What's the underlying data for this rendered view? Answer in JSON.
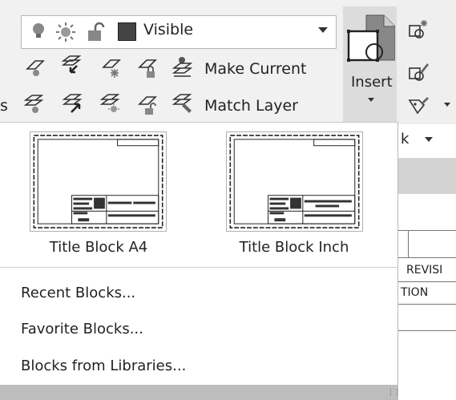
{
  "ribbon": {
    "stub_left": "s",
    "layer_dropdown": {
      "value": "Visible"
    },
    "make_current_label": "Make Current",
    "match_layer_label": "Match Layer",
    "insert_label": "Insert",
    "block_panel_stub": "k"
  },
  "block_gallery": {
    "thumbnails": [
      {
        "label": "Title Block A4"
      },
      {
        "label": "Title Block Inch"
      }
    ],
    "menu_items": [
      {
        "label": "Recent Blocks..."
      },
      {
        "label": "Favorite Blocks..."
      },
      {
        "label": "Blocks from Libraries..."
      }
    ]
  },
  "drawing_area": {
    "revision_fragment": "REVISI",
    "tion_fragment": "TION"
  },
  "colors": {
    "ribbon_bg": "#f1f1f1",
    "panel_bg": "#ffffff",
    "insert_highlight": "#dcdcdc",
    "footer_bar": "#bdbdbd"
  }
}
